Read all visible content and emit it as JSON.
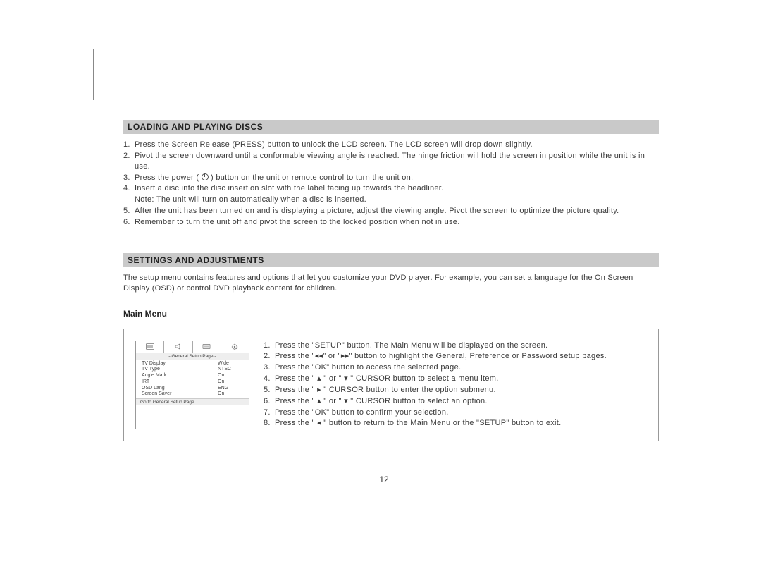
{
  "section1": {
    "title": "LOADING AND PLAYING DISCS",
    "items": [
      [
        "1.",
        "Press the Screen Release (PRESS) button to unlock the LCD screen. The LCD screen will drop down slightly."
      ],
      [
        "2.",
        "Pivot the screen downward until a conformable viewing angle is reached. The hinge friction will hold the screen in position while the unit is in use."
      ],
      [
        "3.",
        "Press the power ( __PWR__ ) button on the unit or remote control to turn the unit on."
      ],
      [
        "4.",
        "Insert a disc into the disc insertion slot with the label facing up towards the headliner."
      ],
      [
        "",
        "Note: The unit will turn on automatically when a disc is inserted."
      ],
      [
        "5.",
        "After the unit has been turned on and is displaying a picture, adjust the viewing angle. Pivot the screen to optimize the picture quality."
      ],
      [
        "6.",
        "Remember to turn the unit off and pivot the screen to the locked position when not in use."
      ]
    ]
  },
  "section2": {
    "title": "SETTINGS AND ADJUSTMENTS",
    "intro": "The setup menu contains features and options that let you customize your DVD player. For example, you can set a language for the On Screen Display (OSD) or control DVD playback content for children.",
    "sub": "Main Menu",
    "osd": {
      "title": "--General Setup Page--",
      "rows": [
        [
          "TV Display",
          "Wide"
        ],
        [
          "TV Type",
          "NTSC"
        ],
        [
          "Angle Mark",
          "On"
        ],
        [
          "IRT",
          "On"
        ],
        [
          "OSD Lang",
          "ENG"
        ],
        [
          "Screen Saver",
          "On"
        ]
      ],
      "footer": "Go to General Setup Page"
    },
    "steps": [
      [
        "1.",
        "Press the \"SETUP\" button. The Main Menu will be displayed on the screen."
      ],
      [
        "2.",
        "Press the \"◂◂\" or \"▸▸\" button to highlight the General, Preference or Password setup pages."
      ],
      [
        "3.",
        "Press the \"OK\" button to access the selected page."
      ],
      [
        "4.",
        "Press the \" ▴ \" or \" ▾ \" CURSOR button to select a menu item."
      ],
      [
        "5.",
        "Press the \" ▸ \" CURSOR button to enter the option submenu."
      ],
      [
        "6.",
        "Press the \" ▴ \" or \" ▾ \" CURSOR button to select an option."
      ],
      [
        "7.",
        "Press the \"OK\" button to confirm your selection."
      ],
      [
        "8.",
        "Press the \" ◂ \" button to return to the Main Menu or the \"SETUP\" button to exit."
      ]
    ]
  },
  "pageNumber": "12"
}
